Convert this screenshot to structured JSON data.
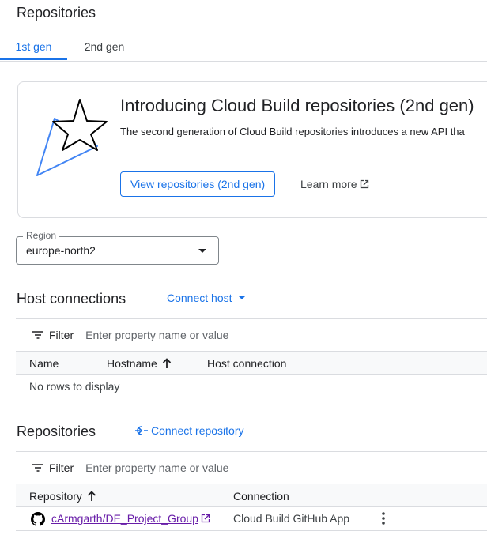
{
  "page": {
    "title": "Repositories"
  },
  "tabs": [
    {
      "label": "1st gen",
      "active": true
    },
    {
      "label": "2nd gen",
      "active": false
    }
  ],
  "promo": {
    "title": "Introducing Cloud Build repositories (2nd gen)",
    "description": "The second generation of Cloud Build repositories introduces a new API tha",
    "primary_button": "View repositories (2nd gen)",
    "learn_more": "Learn more",
    "art_icon": "shooting-star-icon"
  },
  "region": {
    "label": "Region",
    "value": "europe-north2"
  },
  "host_connections": {
    "title": "Host connections",
    "action": "Connect host",
    "filter_label": "Filter",
    "filter_placeholder": "Enter property name or value",
    "columns": [
      "Name",
      "Hostname",
      "Host connection"
    ],
    "sorted_column": "Hostname",
    "empty_text": "No rows to display"
  },
  "repositories": {
    "title": "Repositories",
    "action": "Connect repository",
    "filter_label": "Filter",
    "filter_placeholder": "Enter property name or value",
    "columns": [
      "Repository",
      "Connection"
    ],
    "sorted_column": "Repository",
    "rows": [
      {
        "repository": "cArmgarth/DE_Project_Group",
        "connection": "Cloud Build GitHub App",
        "icon": "github-icon"
      }
    ]
  },
  "colors": {
    "accent": "#1a73e8",
    "visited_link": "#681da8",
    "divider": "#dadce0"
  }
}
